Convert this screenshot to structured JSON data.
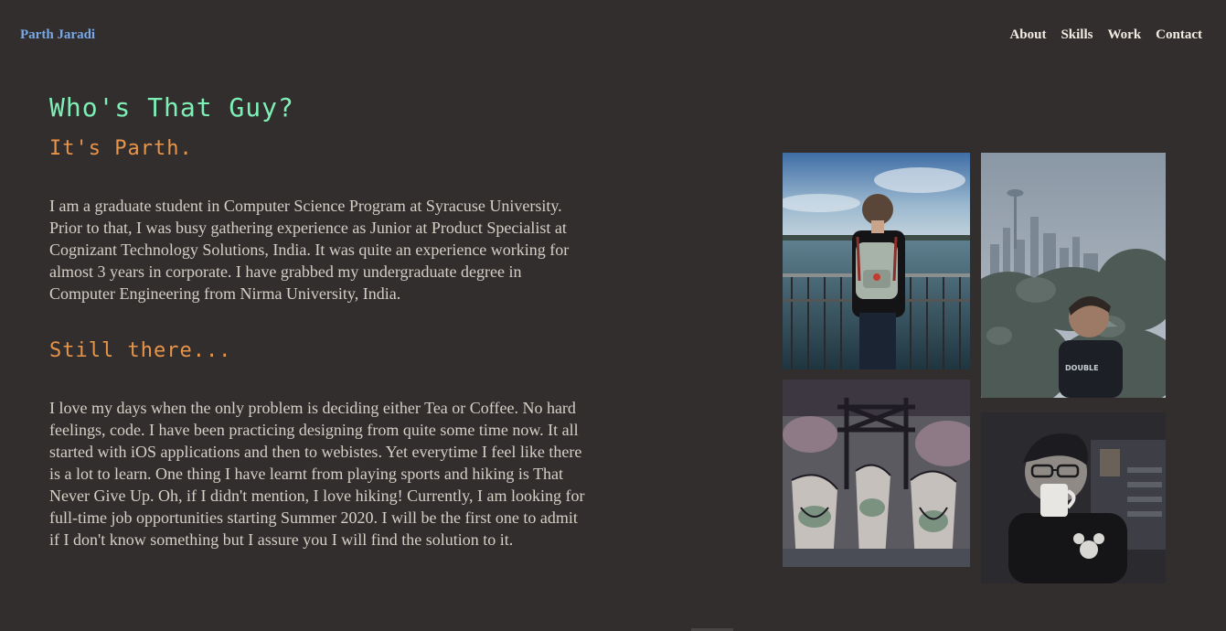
{
  "header": {
    "brand": "Parth Jaradi",
    "nav": [
      {
        "label": "About"
      },
      {
        "label": "Skills"
      },
      {
        "label": "Work"
      },
      {
        "label": "Contact"
      }
    ]
  },
  "about": {
    "title": "Who's That Guy?",
    "subtitle": "It's Parth.",
    "paragraph1": "I am a graduate student in Computer Science Program at Syracuse University. Prior to that, I was busy gathering experience as Junior at Product Specialist at Cognizant Technology Solutions, India. It was quite an experience working for almost 3 years in corporate. I have grabbed my undergraduate degree in Computer Engineering from Nirma University, India.",
    "subtitle2": "Still there...",
    "paragraph2": "I love my days when the only problem is deciding either Tea or Coffee. No hard feelings, code. I have been practicing designing from quite some time now. It all started with iOS applications and then to webistes. Yet everytime I feel like there is a lot to learn. One thing I have learnt from playing sports and hiking is That Never Give Up. Oh, if I didn't mention, I love hiking! Currently, I am looking for full-time job opportunities starting Summer 2020. I will be the first one to admit if I don't know something but I assure you I will find the solution to it."
  },
  "colors": {
    "background": "#322e2e",
    "brand": "#78a8e8",
    "nav": "#f3ece2",
    "title": "#7ef0b6",
    "subtitle": "#e8954a",
    "body_text": "#d5cfc6"
  }
}
